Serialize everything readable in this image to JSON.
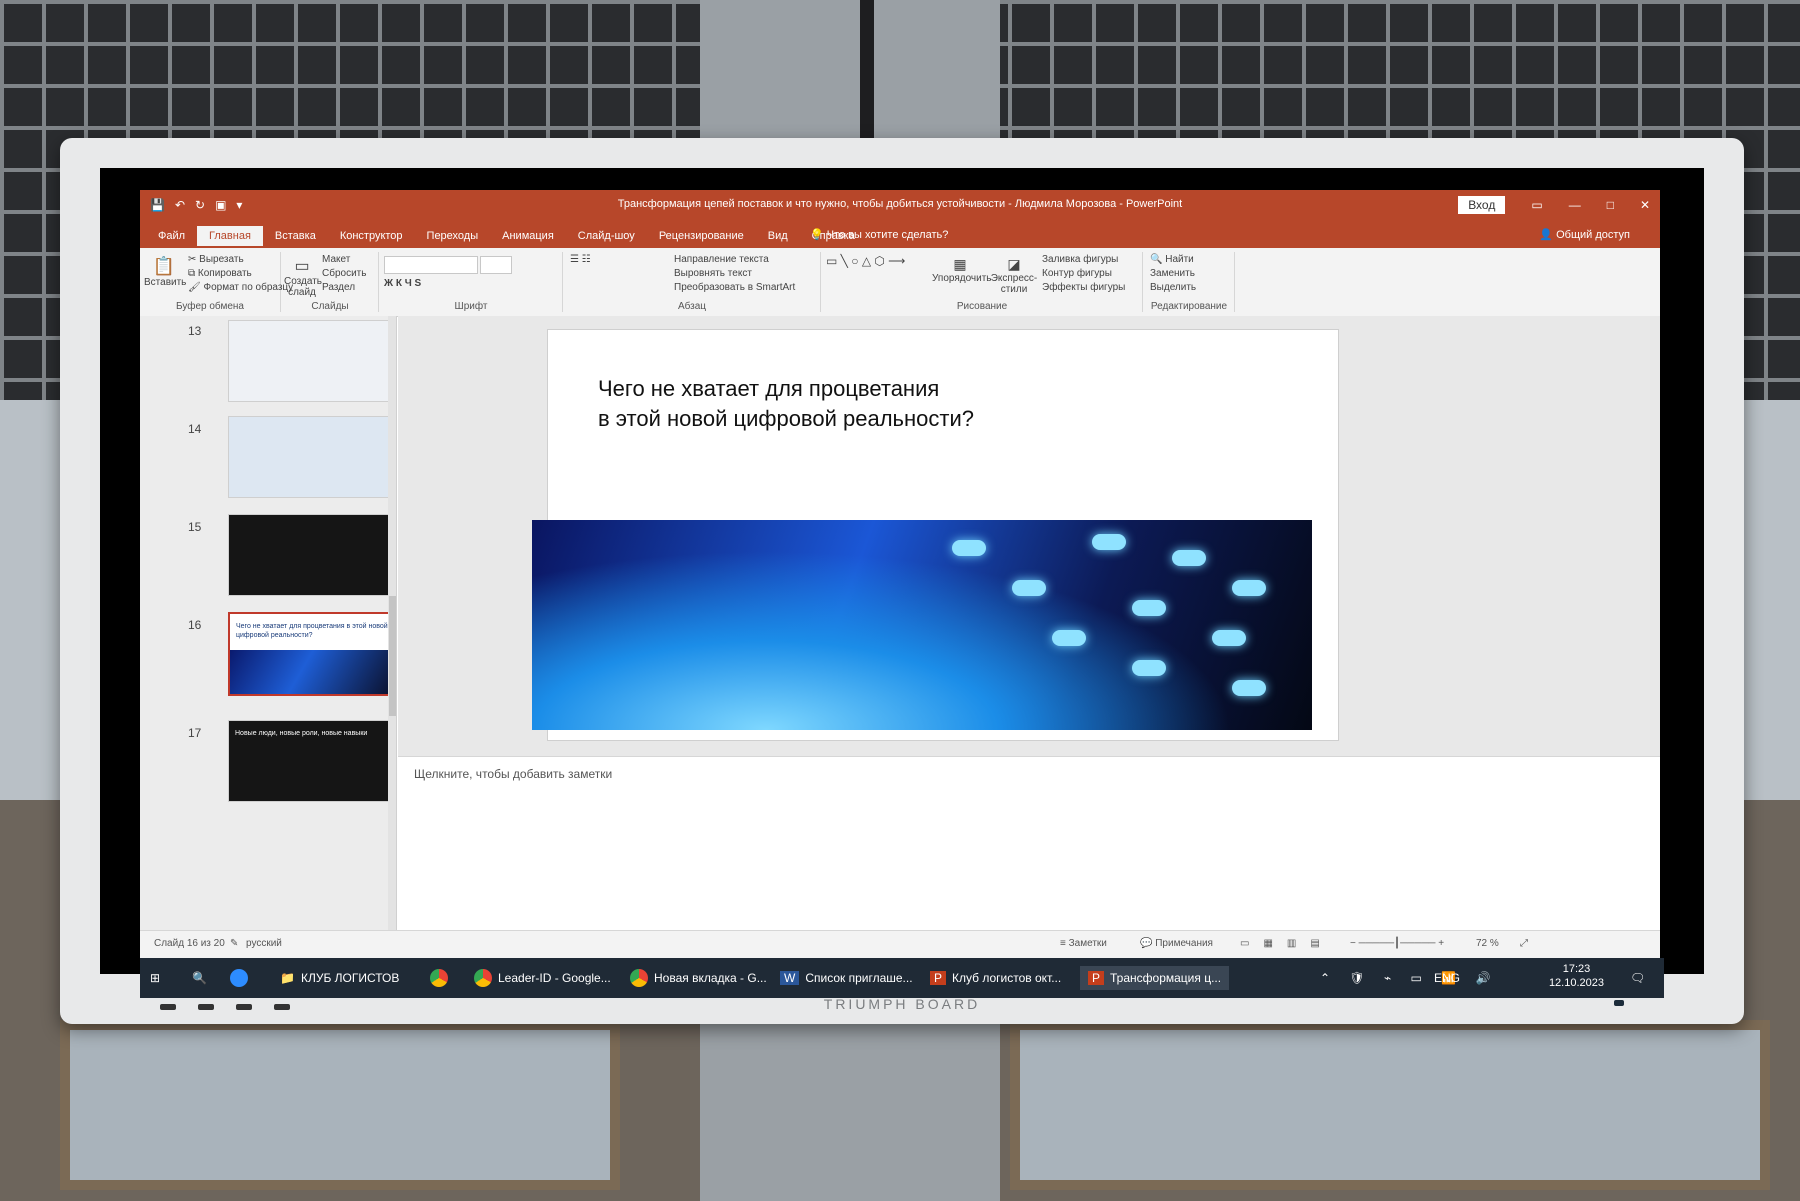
{
  "app": {
    "window_title": "Трансформация цепей поставок и что нужно, чтобы добиться устойчивости - Людмила Морозова - PowerPoint",
    "login": "Вход",
    "share": "Общий доступ",
    "tell_me": "Что вы хотите сделать?"
  },
  "tabs": [
    "Файл",
    "Главная",
    "Вставка",
    "Конструктор",
    "Переходы",
    "Анимация",
    "Слайд-шоу",
    "Рецензирование",
    "Вид",
    "Справка"
  ],
  "ribbon": {
    "paste": "Вставить",
    "cut": "Вырезать",
    "copy": "Копировать",
    "format_painter": "Формат по образцу",
    "clipboard": "Буфер обмена",
    "new_slide": "Создать слайд",
    "layout": "Макет",
    "reset": "Сбросить",
    "section": "Раздел",
    "slides": "Слайды",
    "font_group": "Шрифт",
    "text_direction": "Направление текста",
    "align_text": "Выровнять текст",
    "smartart": "Преобразовать в SmartArt",
    "paragraph": "Абзац",
    "arrange": "Упорядочить",
    "quick_styles": "Экспресс-стили",
    "shape_fill": "Заливка фигуры",
    "shape_outline": "Контур фигуры",
    "shape_effects": "Эффекты фигуры",
    "drawing": "Рисование",
    "find": "Найти",
    "replace": "Заменить",
    "select": "Выделить",
    "editing": "Редактирование"
  },
  "thumbnails": [
    {
      "num": "13",
      "text": ""
    },
    {
      "num": "14",
      "text": ""
    },
    {
      "num": "15",
      "text": ""
    },
    {
      "num": "16",
      "text": "Чего не хватает для процветания в этой новой цифровой реальности?"
    },
    {
      "num": "17",
      "text": "Новые люди, новые роли, новые навыки"
    }
  ],
  "slide": {
    "title_line1": "Чего не хватает для процветания",
    "title_line2": "в этой новой цифровой реальности?"
  },
  "notes_placeholder": "Щелкните, чтобы добавить заметки",
  "status": {
    "slide_counter": "Слайд 16 из 20",
    "language": "русский",
    "notes": "Заметки",
    "comments": "Примечания",
    "zoom": "72 %"
  },
  "taskbar": {
    "club": "КЛУБ ЛОГИСТОВ",
    "leader_id": "Leader-ID - Google...",
    "new_tab": "Новая вкладка - G...",
    "invite_list": "Список приглаше...",
    "club_ppt": "Клуб логистов окт...",
    "transform_ppt": "Трансформация ц...",
    "lang": "ENG",
    "time": "17:23",
    "date": "12.10.2023"
  },
  "monitor_brand": "TRIUMPH BOARD"
}
